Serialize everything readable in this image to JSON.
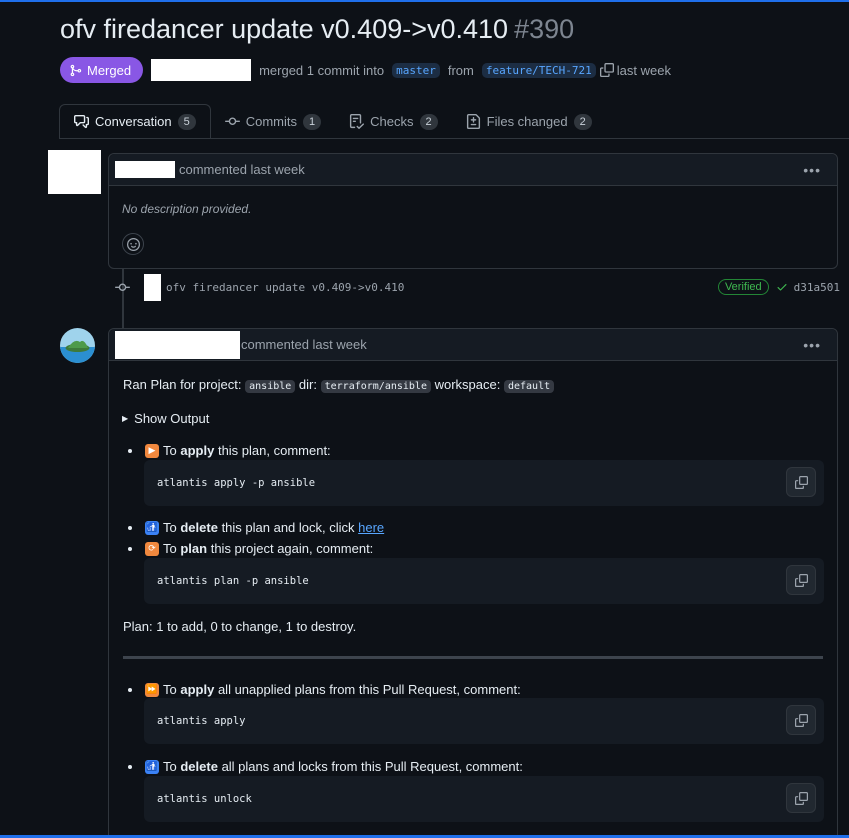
{
  "pr": {
    "title": "ofv firedancer update v0.409->v0.410",
    "number": "#390",
    "status": "Merged",
    "merge_text": "merged 1 commit into",
    "base_branch": "master",
    "from_text": "from",
    "head_branch": "feature/TECH-721",
    "time": "last week"
  },
  "tabs": [
    {
      "label": "Conversation",
      "count": "5"
    },
    {
      "label": "Commits",
      "count": "1"
    },
    {
      "label": "Checks",
      "count": "2"
    },
    {
      "label": "Files changed",
      "count": "2"
    }
  ],
  "comment1": {
    "action": "commented last week",
    "body": "No description provided."
  },
  "commit": {
    "message": "ofv firedancer update v0.409->v0.410",
    "verified": "Verified",
    "sha": "d31a501"
  },
  "comment2": {
    "action": "commented last week",
    "ran_plan": "Ran Plan for project:",
    "project": "ansible",
    "dir_label": "dir:",
    "dir": "terraform/ansible",
    "workspace_label": "workspace:",
    "workspace": "default",
    "show_output": "Show Output",
    "apply_pre": "To",
    "apply_bold": "apply",
    "apply_post": "this plan, comment:",
    "apply_cmd": "atlantis apply -p ansible",
    "delete_pre": "To",
    "delete_bold": "delete",
    "delete_post": "this plan and lock, click",
    "delete_link": "here",
    "plan_pre": "To",
    "plan_bold": "plan",
    "plan_post": "this project again, comment:",
    "plan_cmd": "atlantis plan -p ansible",
    "summary": "Plan: 1 to add, 0 to change, 1 to destroy.",
    "apply_all_pre": "To",
    "apply_all_bold": "apply",
    "apply_all_post": "all unapplied plans from this Pull Request, comment:",
    "apply_all_cmd": "atlantis apply",
    "delete_all_pre": "To",
    "delete_all_bold": "delete",
    "delete_all_post": "all plans and locks from this Pull Request, comment:",
    "delete_all_cmd": "atlantis unlock"
  },
  "colors": {
    "merged": "#8957e5",
    "link": "#58a6ff",
    "verified": "#3fb950"
  }
}
